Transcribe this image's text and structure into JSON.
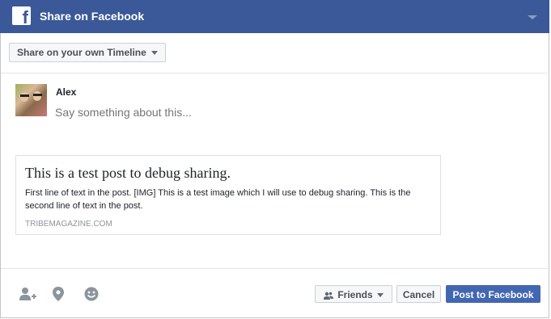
{
  "header": {
    "title": "Share on Facebook",
    "logo_letter": "f"
  },
  "share_target": {
    "label": "Share on your own Timeline"
  },
  "composer": {
    "user_name": "Alex",
    "placeholder": "Say something about this..."
  },
  "link_card": {
    "title": "This is a test post to debug sharing.",
    "description": "First line of text in the post. [IMG] This is a test image which I will use to debug sharing. This is the second line of text in the post.",
    "domain": "TRIBEMAGAZINE.COM"
  },
  "footer": {
    "icons": [
      "tag-friends-icon",
      "location-icon",
      "feeling-icon"
    ],
    "audience_label": "Friends",
    "cancel_label": "Cancel",
    "post_label": "Post to Facebook"
  },
  "colors": {
    "brand": "#3b5998",
    "post_button": "#4267b2",
    "muted_icon": "#8d949e"
  }
}
